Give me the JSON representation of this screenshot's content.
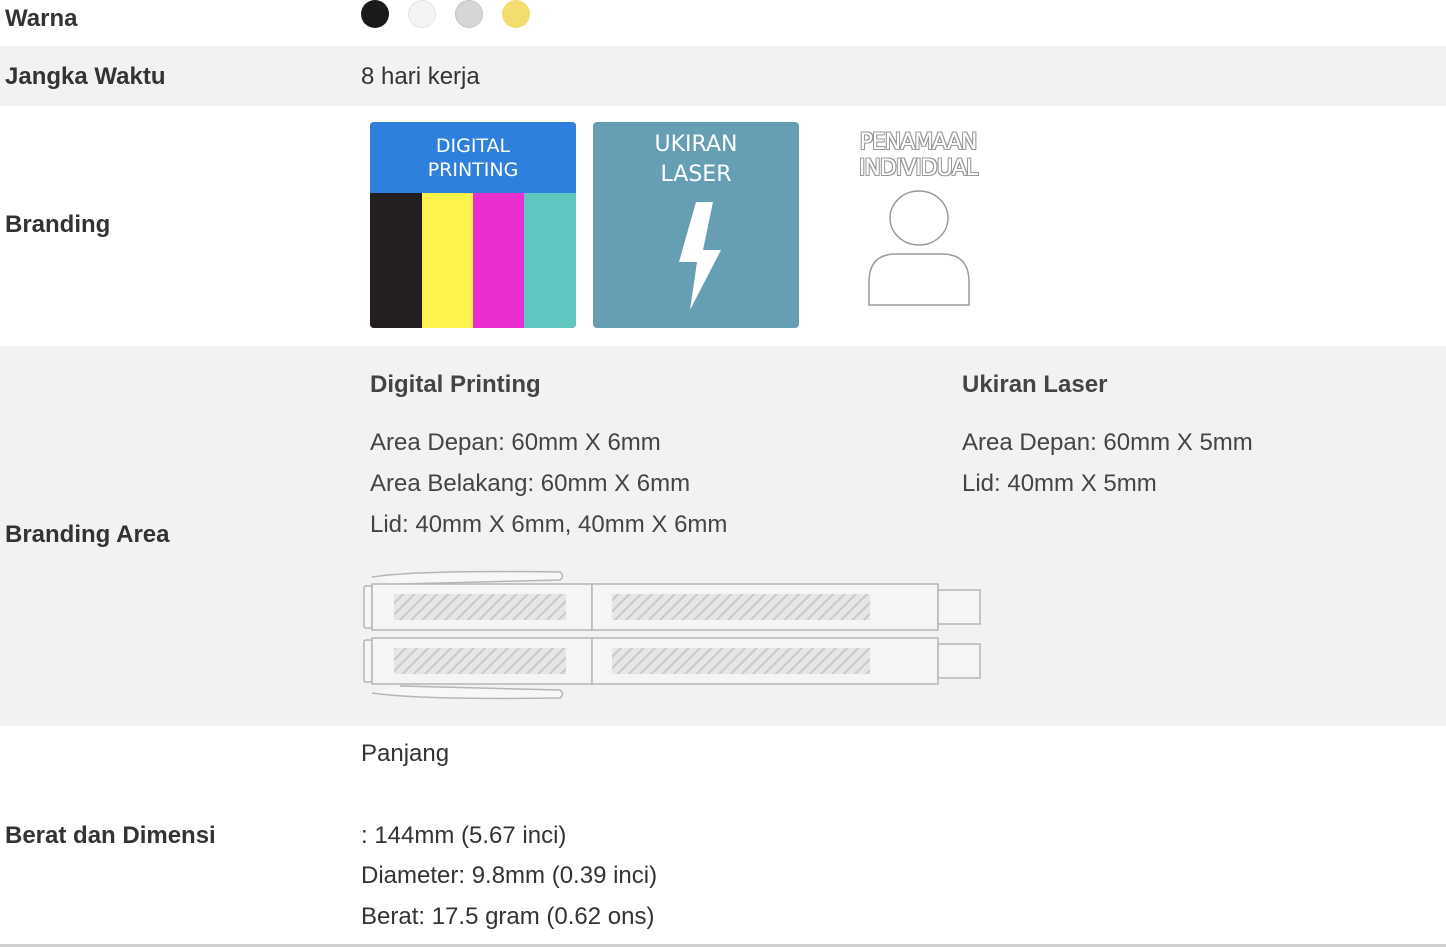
{
  "warna": {
    "label": "Warna",
    "colors": [
      {
        "name": "black",
        "hex": "#1a1a1a"
      },
      {
        "name": "white",
        "hex": "#f4f4f4"
      },
      {
        "name": "silver",
        "hex": "#d6d6d6"
      },
      {
        "name": "gold",
        "hex": "#f2dd6e"
      }
    ]
  },
  "jangka_waktu": {
    "label": "Jangka Waktu",
    "value": "8 hari kerja"
  },
  "branding": {
    "label": "Branding",
    "digital_printing": {
      "line1": "DIGITAL",
      "line2": "PRINTING",
      "colors": [
        "#231f20",
        "#fff24a",
        "#e92fce",
        "#5fc7c0"
      ]
    },
    "ukiran_laser": {
      "line1": "UKIRAN",
      "line2": "LASER"
    },
    "penamaan_individual": {
      "line1": "PENAMAAN",
      "line2": "INDIVIDUAL"
    }
  },
  "branding_area": {
    "label": "Branding Area",
    "digital_printing": {
      "title": "Digital Printing",
      "lines": [
        "Area Depan: 60mm X 6mm",
        "Area Belakang: 60mm X 6mm",
        "Lid: 40mm X 6mm, 40mm X 6mm"
      ]
    },
    "ukiran_laser": {
      "title": "Ukiran Laser",
      "lines": [
        "Area Depan: 60mm X 5mm",
        "Lid: 40mm X 5mm"
      ]
    }
  },
  "berat_dimensi": {
    "label": "Berat dan Dimensi",
    "panjang_label": "Panjang",
    "lines": [
      ": 144mm (5.67 inci)",
      "Diameter: 9.8mm (0.39 inci)",
      "Berat: 17.5 gram (0.62 ons)"
    ]
  },
  "colors": {
    "row_alt_bg": "#f3f2f3",
    "dp_blue": "#2f80dc",
    "laser_teal": "#669eb3",
    "text": "#333333"
  }
}
